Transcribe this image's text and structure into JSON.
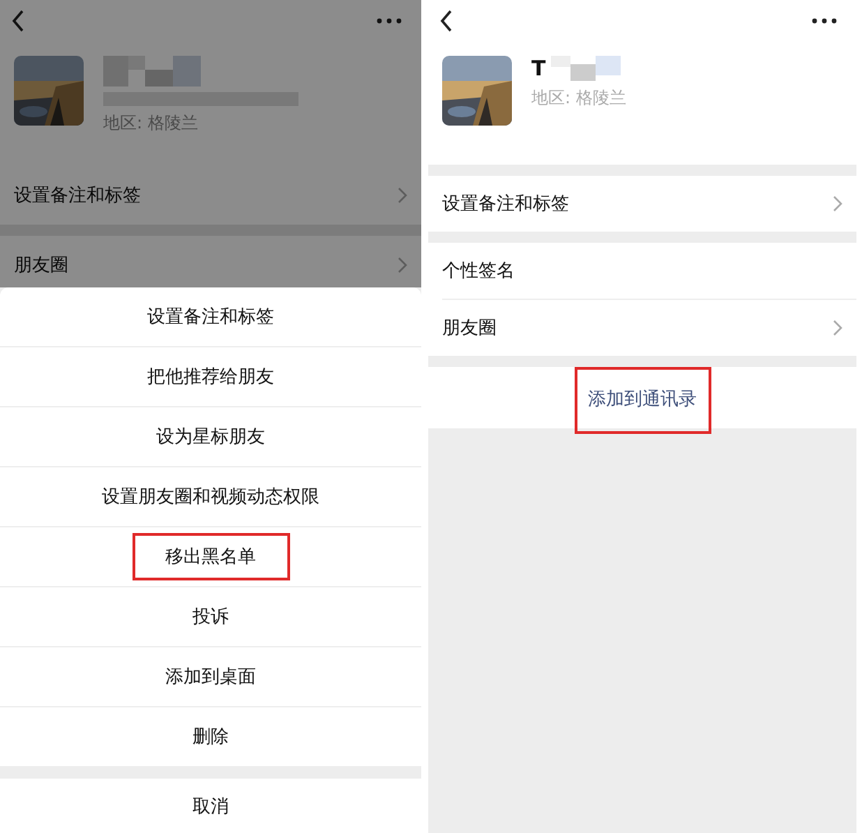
{
  "left_screen": {
    "dimmed": true,
    "profile": {
      "region": "地区: 格陵兰"
    },
    "rows": [
      {
        "label": "设置备注和标签",
        "kind": "link"
      },
      {
        "label": "朋友圈",
        "kind": "link"
      }
    ],
    "action_sheet": {
      "items": [
        {
          "label": "设置备注和标签",
          "highlighted": false
        },
        {
          "label": "把他推荐给朋友",
          "highlighted": false
        },
        {
          "label": "设为星标朋友",
          "highlighted": false
        },
        {
          "label": "设置朋友圈和视频动态权限",
          "highlighted": false
        },
        {
          "label": "移出黑名单",
          "highlighted": true
        },
        {
          "label": "投诉",
          "highlighted": false
        },
        {
          "label": "添加到桌面",
          "highlighted": false
        },
        {
          "label": "删除",
          "highlighted": false
        }
      ],
      "cancel": "取消"
    }
  },
  "right_screen": {
    "profile": {
      "name": "T",
      "region": "地区: 格陵兰"
    },
    "groups": [
      [
        {
          "label": "设置备注和标签",
          "kind": "link"
        }
      ],
      [
        {
          "label": "个性签名",
          "kind": "text"
        },
        {
          "label": "朋友圈",
          "kind": "link"
        }
      ]
    ],
    "action": {
      "label": "添加到通讯录",
      "highlighted": true
    }
  }
}
